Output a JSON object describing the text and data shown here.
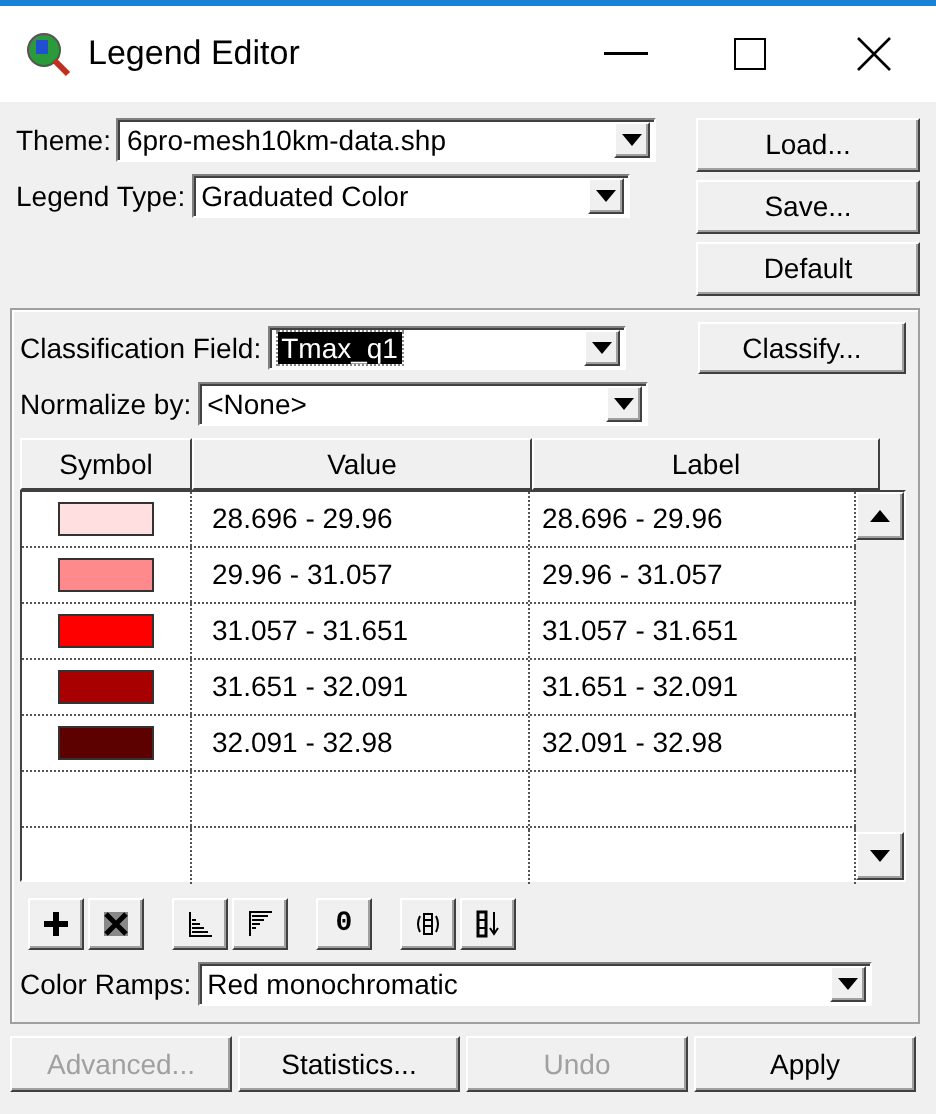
{
  "window": {
    "title": "Legend Editor"
  },
  "theme": {
    "label": "Theme:",
    "value": "6pro-mesh10km-data.shp"
  },
  "legend_type": {
    "label": "Legend Type:",
    "value": "Graduated Color"
  },
  "side_buttons": [
    {
      "label": "Load..."
    },
    {
      "label": "Save..."
    },
    {
      "label": "Default"
    }
  ],
  "classification_field": {
    "label": "Classification Field:",
    "value": "Tmax_q1",
    "selected": true
  },
  "classify_button": {
    "label": "Classify..."
  },
  "normalize": {
    "label": "Normalize by:",
    "value": "<None>"
  },
  "table": {
    "columns": [
      "Symbol",
      "Value",
      "Label"
    ],
    "rows": [
      {
        "color": "#ffdfe0",
        "value": "28.696 - 29.96",
        "label": "28.696 - 29.96"
      },
      {
        "color": "#ff8a8c",
        "value": "29.96 - 31.057",
        "label": "29.96 - 31.057"
      },
      {
        "color": "#ff0000",
        "value": "31.057 - 31.651",
        "label": "31.057 - 31.651"
      },
      {
        "color": "#a80000",
        "value": "31.651 - 32.091",
        "label": "31.651 - 32.091"
      },
      {
        "color": "#5c0000",
        "value": "32.091 - 32.98",
        "label": "32.091 - 32.98"
      }
    ]
  },
  "tools": [
    {
      "kind": "add"
    },
    {
      "kind": "delete"
    },
    {
      "kind": "ascending"
    },
    {
      "kind": "descending"
    },
    {
      "kind": "text",
      "label": "0"
    },
    {
      "kind": "flip"
    },
    {
      "kind": "sort"
    }
  ],
  "color_ramps": {
    "label": "Color Ramps:",
    "value": "Red monochromatic"
  },
  "bottom_buttons": [
    {
      "label": "Advanced...",
      "disabled": true
    },
    {
      "label": "Statistics...",
      "disabled": false
    },
    {
      "label": "Undo",
      "disabled": true
    },
    {
      "label": "Apply",
      "disabled": false
    }
  ]
}
